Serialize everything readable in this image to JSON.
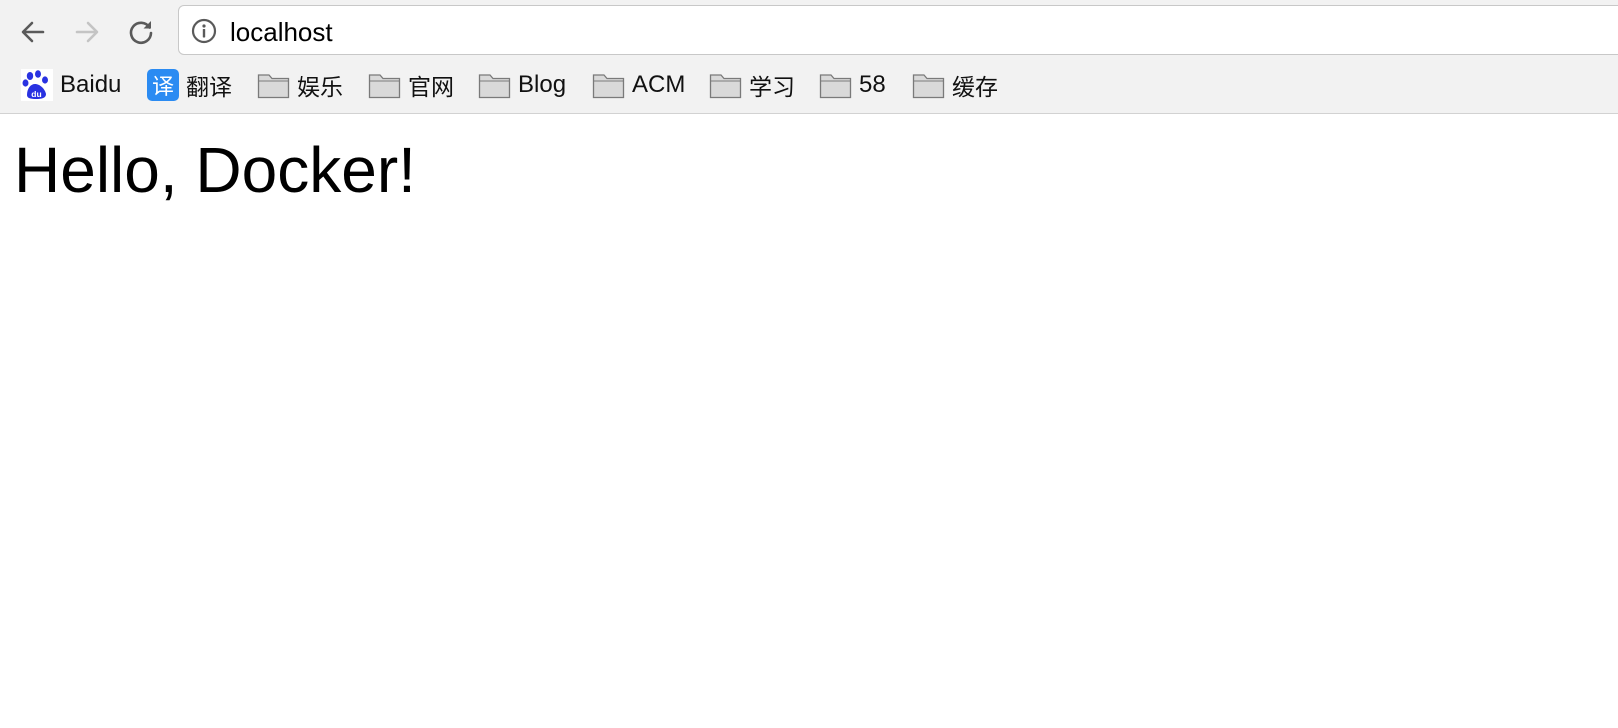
{
  "browser": {
    "nav": {
      "back_icon": "arrow-left-icon",
      "forward_icon": "arrow-right-icon",
      "reload_icon": "reload-icon"
    },
    "address_bar": {
      "icon": "info-icon",
      "url": "localhost"
    },
    "bookmarks": [
      {
        "label": "Baidu",
        "icon": "baidu-paw-icon"
      },
      {
        "label": "翻译",
        "icon": "translate-icon",
        "icon_text": "译"
      },
      {
        "label": "娱乐",
        "icon": "folder-icon"
      },
      {
        "label": "官网",
        "icon": "folder-icon"
      },
      {
        "label": "Blog",
        "icon": "folder-icon"
      },
      {
        "label": "ACM",
        "icon": "folder-icon"
      },
      {
        "label": "学习",
        "icon": "folder-icon"
      },
      {
        "label": "58",
        "icon": "folder-icon"
      },
      {
        "label": "缓存",
        "icon": "folder-icon"
      }
    ]
  },
  "page": {
    "heading": "Hello, Docker!"
  },
  "colors": {
    "toolbar_bg": "#f2f2f2",
    "translate_icon_bg": "#2b8bf2",
    "baidu_blue": "#2932e1"
  }
}
